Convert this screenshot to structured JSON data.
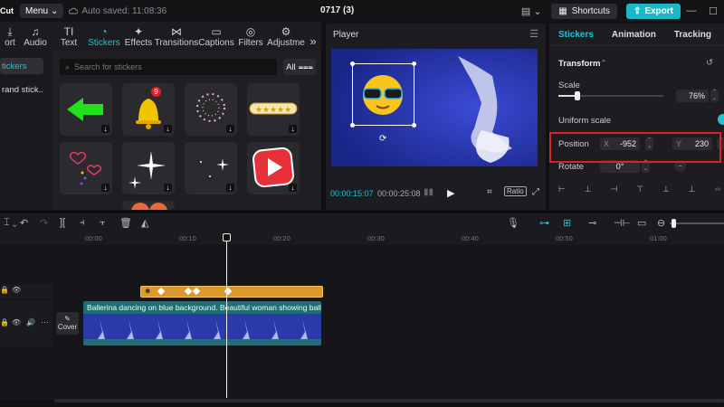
{
  "topbar": {
    "logo": "Cut",
    "menu_label": "Menu",
    "autosave": "Auto saved: 11:08:36",
    "project_title": "0717 (3)",
    "shortcuts_label": "Shortcuts",
    "export_label": "Export"
  },
  "tools": {
    "tabs": [
      {
        "label": "ort",
        "icon": "import-icon"
      },
      {
        "label": "Audio",
        "icon": "audio-icon"
      },
      {
        "label": "Text",
        "icon": "text-icon"
      },
      {
        "label": "Stickers",
        "icon": "stickers-icon",
        "active": true
      },
      {
        "label": "Effects",
        "icon": "effects-icon"
      },
      {
        "label": "Transitions",
        "icon": "transitions-icon"
      },
      {
        "label": "Captions",
        "icon": "captions-icon"
      },
      {
        "label": "Filters",
        "icon": "filters-icon"
      },
      {
        "label": "Adjustme",
        "icon": "adjustment-icon"
      }
    ]
  },
  "left_sub": {
    "items": [
      {
        "label": "tickers",
        "active": true
      },
      {
        "label": "rand stick...",
        "active": false
      }
    ]
  },
  "stickers": {
    "search_placeholder": "Search for stickers",
    "filter_label": "All",
    "badge_count": "9"
  },
  "player": {
    "title": "Player",
    "current_time": "00:00:15:07",
    "total_time": "00:00:25:08",
    "ratio_label": "Ratio"
  },
  "inspector": {
    "tabs": [
      "Stickers",
      "Animation",
      "Tracking"
    ],
    "section_title": "Transform",
    "scale_label": "Scale",
    "scale_value": "76%",
    "scale_fraction": 0.76,
    "uniform_scale_label": "Uniform scale",
    "position_label": "Position",
    "pos_x_label": "X",
    "pos_x_value": "-952",
    "pos_y_label": "Y",
    "pos_y_value": "230",
    "rotate_label": "Rotate",
    "rotate_value": "0°"
  },
  "timeline": {
    "ruler": [
      "00:00",
      "00:10",
      "00:20",
      "00:30",
      "00:40",
      "00:50",
      "01:00"
    ],
    "video_clip_label": "Ballerina dancing on blue background. Beautiful woman showing ballet m",
    "cover_label": "Cover"
  },
  "colors": {
    "accent": "#20c3d2",
    "highlight_box": "#e02020",
    "sticker_clip": "#d99a2b",
    "video_clip": "#1d6f73"
  }
}
